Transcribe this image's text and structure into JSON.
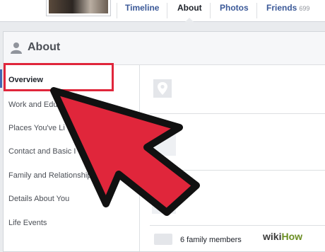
{
  "nav": {
    "tabs": [
      {
        "label": "Timeline"
      },
      {
        "label": "About"
      },
      {
        "label": "Photos"
      },
      {
        "label": "Friends",
        "count": "699"
      }
    ]
  },
  "about": {
    "title": "About",
    "sidebar": [
      {
        "label": "Overview"
      },
      {
        "label": "Work and Edu"
      },
      {
        "label": "Places You've Li"
      },
      {
        "label": "Contact and Basic I"
      },
      {
        "label": "Family and Relationship"
      },
      {
        "label": "Details About You"
      },
      {
        "label": "Life Events"
      }
    ],
    "family_text": "6 family members"
  },
  "watermark": {
    "wiki": "wiki",
    "how": "How"
  },
  "colors": {
    "highlight": "#e0263b",
    "arrow": "#e0263b",
    "link": "#3b5998"
  },
  "icons": [
    "person-icon",
    "map-pin-icon",
    "family-icon",
    "pointer-arrow-icon"
  ]
}
